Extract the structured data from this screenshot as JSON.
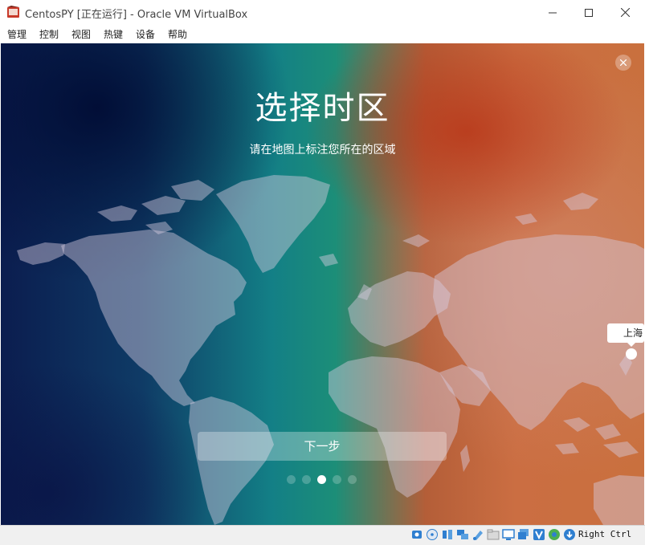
{
  "window": {
    "title": "CentosPY [正在运行] - Oracle VM VirtualBox"
  },
  "menubar": {
    "items": [
      "管理",
      "控制",
      "视图",
      "热键",
      "设备",
      "帮助"
    ]
  },
  "installer": {
    "heading": "选择时区",
    "subheading": "请在地图上标注您所在的区域",
    "selected_city": "上海",
    "next_label": "下一步",
    "steps_total": 5,
    "current_step": 3
  },
  "statusbar": {
    "icons": [
      "hard-disk-icon",
      "optical-drive-icon",
      "audio-icon",
      "network-icon",
      "usb-icon",
      "shared-folders-icon",
      "display-icon",
      "video-capture-icon",
      "virtualization-icon",
      "mouse-integration-icon",
      "keyboard-icon"
    ],
    "host_key": "Right Ctrl"
  },
  "colors": {
    "accent_white": "#ffffff",
    "bg_left": "#0b1d4f",
    "bg_mid": "#137f86",
    "bg_right": "#cb6e42"
  }
}
